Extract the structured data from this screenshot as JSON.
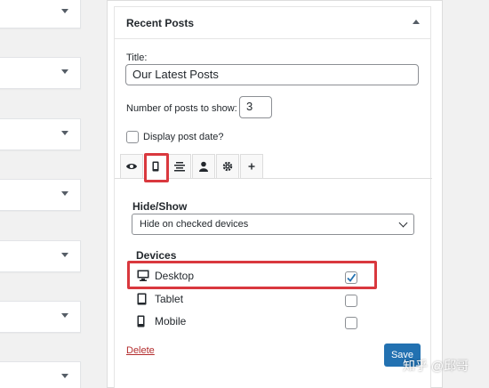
{
  "widget": {
    "title": "Recent Posts",
    "title_field_label": "Title:",
    "title_field_value": "Our Latest Posts",
    "number_label": "Number of posts to show:",
    "number_value": "3",
    "display_date_label": "Display post date?",
    "display_date_checked": false
  },
  "tabs": [
    {
      "icon": "eye-icon",
      "active": false
    },
    {
      "icon": "mobile-icon",
      "active": true
    },
    {
      "icon": "align-center-icon",
      "active": false
    },
    {
      "icon": "user-icon",
      "active": false
    },
    {
      "icon": "gear-icon",
      "active": false
    },
    {
      "icon": "plus-icon",
      "active": false
    }
  ],
  "hideshow": {
    "label": "Hide/Show",
    "selected": "Hide on checked devices"
  },
  "devices": {
    "label": "Devices",
    "items": [
      {
        "label": "Desktop",
        "icon": "desktop-icon",
        "checked": true
      },
      {
        "label": "Tablet",
        "icon": "tablet-icon",
        "checked": false
      },
      {
        "label": "Mobile",
        "icon": "mobile-icon",
        "checked": false
      }
    ]
  },
  "actions": {
    "delete_label": "Delete",
    "save_label": "Save"
  },
  "watermark": "知乎 @邱哥",
  "colors": {
    "highlight": "#d9383e",
    "primary": "#2271b1",
    "delete": "#b32d2e"
  }
}
